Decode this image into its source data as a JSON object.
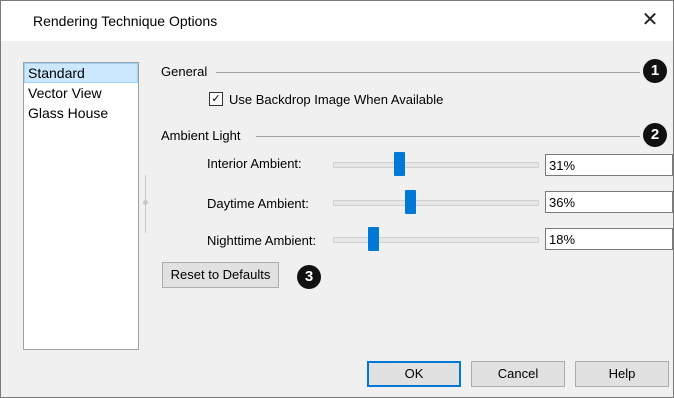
{
  "dialog": {
    "title": "Rendering Technique Options"
  },
  "list": {
    "items": [
      {
        "label": "Standard",
        "selected": true
      },
      {
        "label": "Vector View"
      },
      {
        "label": "Glass House"
      }
    ]
  },
  "general": {
    "label": "General",
    "badge": "1",
    "backdrop_checkbox": {
      "label": "Use Backdrop Image When Available",
      "checked": true,
      "mark": "✓"
    }
  },
  "ambient": {
    "label": "Ambient Light",
    "badge": "2",
    "interior": {
      "label": "Interior Ambient:",
      "value": "31%",
      "slider_fraction": 0.31
    },
    "daytime": {
      "label": "Daytime Ambient:",
      "value": "36%",
      "slider_fraction": 0.36
    },
    "nighttime": {
      "label": "Nighttime Ambient:",
      "value": "18%",
      "slider_fraction": 0.18
    }
  },
  "reset": {
    "label": "Reset to Defaults",
    "badge": "3"
  },
  "buttons": {
    "ok": "OK",
    "cancel": "Cancel",
    "help": "Help"
  },
  "icons": {
    "close": "close-icon",
    "check": "check-icon"
  },
  "colors": {
    "accent": "#0078d7",
    "selection": "#cce8ff"
  }
}
